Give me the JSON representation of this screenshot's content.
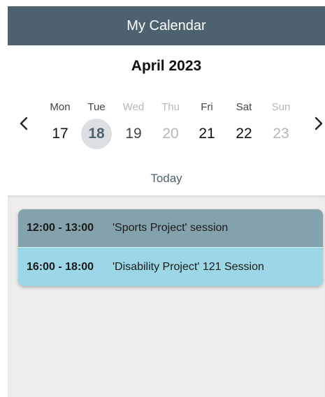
{
  "header": {
    "title": "My Calendar"
  },
  "calendar": {
    "month_label": "April 2023",
    "prev_icon": "chevron-left-icon",
    "next_icon": "chevron-right-icon",
    "days": [
      {
        "name": "Mon",
        "number": "17",
        "state": "normal"
      },
      {
        "name": "Tue",
        "number": "18",
        "state": "selected"
      },
      {
        "name": "Wed",
        "number": "19",
        "state": "muted-name"
      },
      {
        "name": "Thu",
        "number": "20",
        "state": "muted"
      },
      {
        "name": "Fri",
        "number": "21",
        "state": "normal"
      },
      {
        "name": "Sat",
        "number": "22",
        "state": "normal"
      },
      {
        "name": "Sun",
        "number": "23",
        "state": "muted"
      }
    ],
    "today_label": "Today"
  },
  "events": [
    {
      "time": "12:00 - 13:00",
      "title": "'Sports Project' session",
      "color": "#84a2ab"
    },
    {
      "time": "16:00 - 18:00",
      "title": "'Disability Project' 121 Session",
      "color": "#9bd7e6"
    }
  ],
  "colors": {
    "header": "#4d626e",
    "selected_day": "#dcdfe1",
    "background": "#ececec"
  }
}
